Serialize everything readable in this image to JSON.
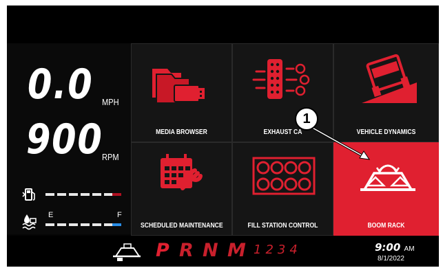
{
  "speed": {
    "value": "0.0",
    "unit": "MPH"
  },
  "rpm": {
    "value": "900",
    "unit": "RPM"
  },
  "fuel": {
    "icon": "fuel-pump-icon"
  },
  "def": {
    "icon": "def-fluid-icon",
    "empty_label": "E",
    "full_label": "F"
  },
  "tiles": [
    {
      "label": "MEDIA BROWSER",
      "icon": "folder-usb-icon",
      "selected": false
    },
    {
      "label": "EXHAUST CA",
      "icon": "exhaust-filter-icon",
      "selected": false
    },
    {
      "label": "VEHICLE DYNAMICS",
      "icon": "tilted-vehicle-icon",
      "selected": false
    },
    {
      "label": "SCHEDULED MAINTENANCE",
      "icon": "calendar-wrench-icon",
      "selected": false
    },
    {
      "label": "FILL STATION CONTROL",
      "icon": "fill-station-grid-icon",
      "selected": false
    },
    {
      "label": "BOOM RACK",
      "icon": "boom-rack-icon",
      "selected": true
    }
  ],
  "callout": {
    "number": "1"
  },
  "gears": {
    "p": "P",
    "r": "R",
    "n": "N",
    "m": "M",
    "numbers": "1234"
  },
  "clock": {
    "time": "9:00",
    "ampm": "AM",
    "date": "8/1/2022"
  },
  "colors": {
    "accent": "#e02030",
    "background": "#050505",
    "def_level": "#2a8ee8"
  }
}
